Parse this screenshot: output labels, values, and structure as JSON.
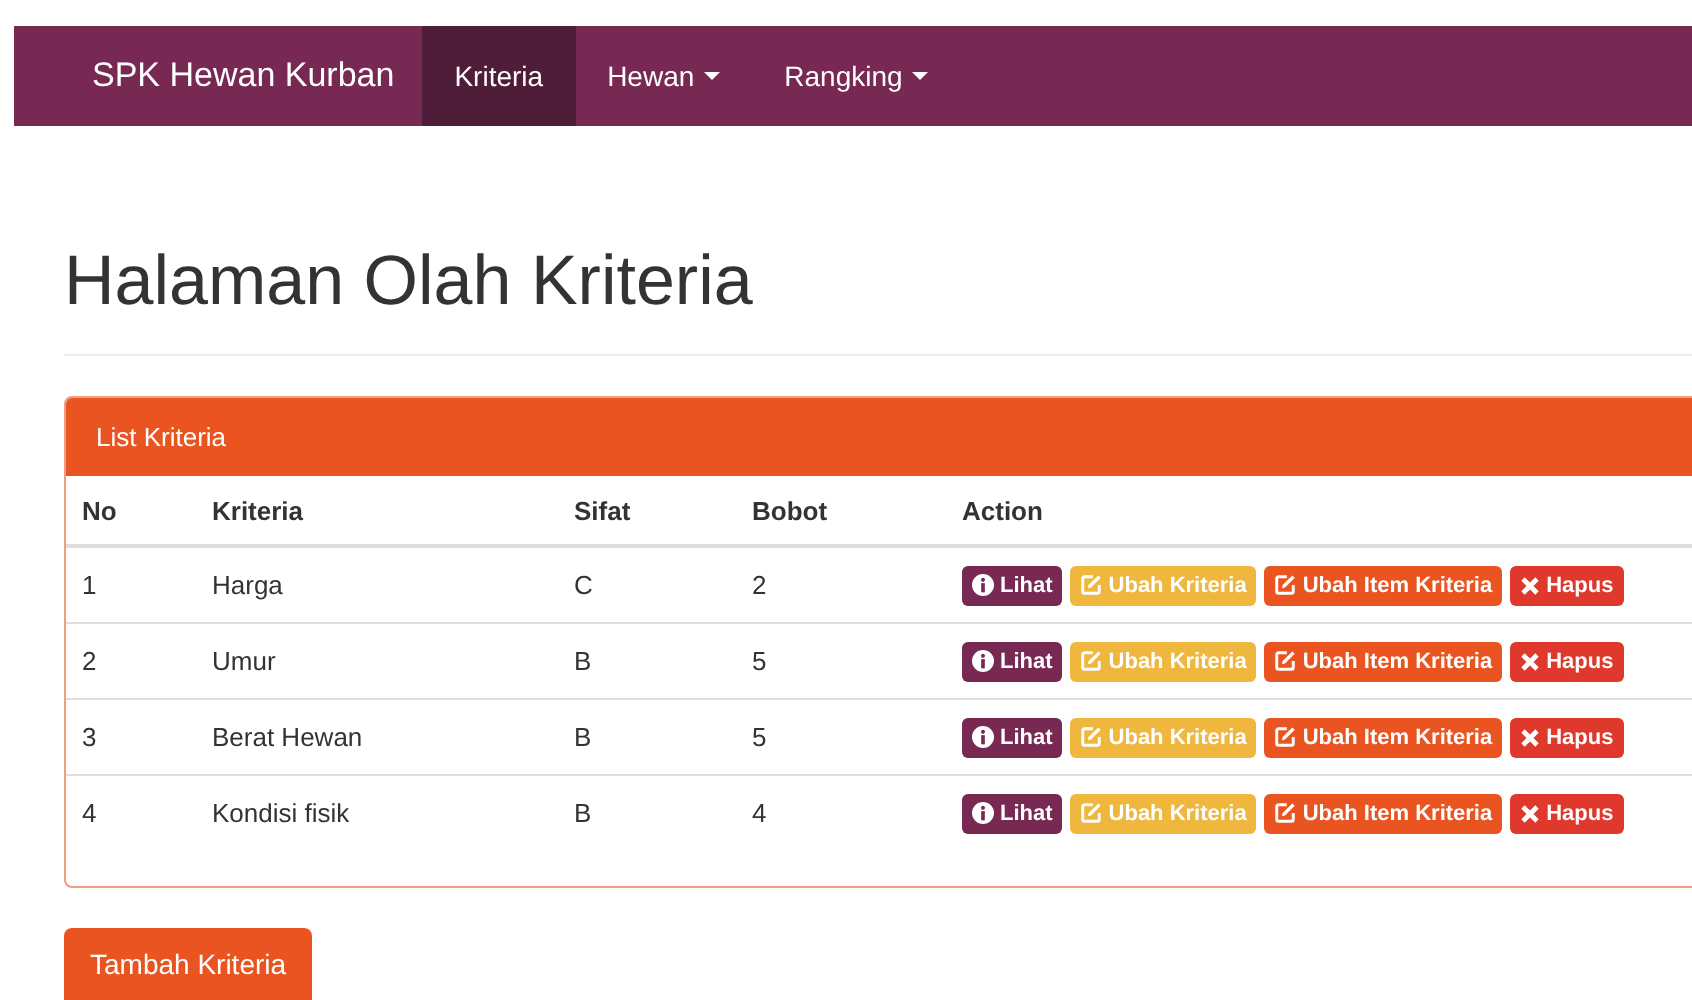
{
  "navbar": {
    "brand": "SPK Hewan Kurban",
    "items": [
      {
        "label": "Kriteria",
        "selected": true,
        "dropdown": false
      },
      {
        "label": "Hewan",
        "selected": false,
        "dropdown": true
      },
      {
        "label": "Rangking",
        "selected": false,
        "dropdown": true
      }
    ]
  },
  "page_title": "Halaman Olah Kriteria",
  "panel": {
    "title": "List Kriteria",
    "table": {
      "columns": [
        "No",
        "Kriteria",
        "Sifat",
        "Bobot",
        "Action"
      ],
      "rows": [
        {
          "cells": [
            "1",
            "Harga",
            "C",
            "2"
          ],
          "actions": [
            {
              "label": "Lihat",
              "kind": "view"
            },
            {
              "label": "Ubah Kriteria",
              "kind": "edit"
            },
            {
              "label": "Ubah Item Kriteria",
              "kind": "edit-item"
            },
            {
              "label": "Hapus",
              "kind": "delete"
            }
          ]
        },
        {
          "cells": [
            "2",
            "Umur",
            "B",
            "5"
          ],
          "actions": [
            {
              "label": "Lihat",
              "kind": "view"
            },
            {
              "label": "Ubah Kriteria",
              "kind": "edit"
            },
            {
              "label": "Ubah Item Kriteria",
              "kind": "edit-item"
            },
            {
              "label": "Hapus",
              "kind": "delete"
            }
          ]
        },
        {
          "cells": [
            "3",
            "Berat Hewan",
            "B",
            "5"
          ],
          "actions": [
            {
              "label": "Lihat",
              "kind": "view"
            },
            {
              "label": "Ubah Kriteria",
              "kind": "edit"
            },
            {
              "label": "Ubah Item Kriteria",
              "kind": "edit-item"
            },
            {
              "label": "Hapus",
              "kind": "delete"
            }
          ]
        },
        {
          "cells": [
            "4",
            "Kondisi fisik",
            "B",
            "4"
          ],
          "actions": [
            {
              "label": "Lihat",
              "kind": "view"
            },
            {
              "label": "Ubah Kriteria",
              "kind": "edit"
            },
            {
              "label": "Ubah Item Kriteria",
              "kind": "edit-item"
            },
            {
              "label": "Hapus",
              "kind": "delete"
            }
          ]
        }
      ]
    }
  },
  "add_button": "Tambah Kriteria"
}
